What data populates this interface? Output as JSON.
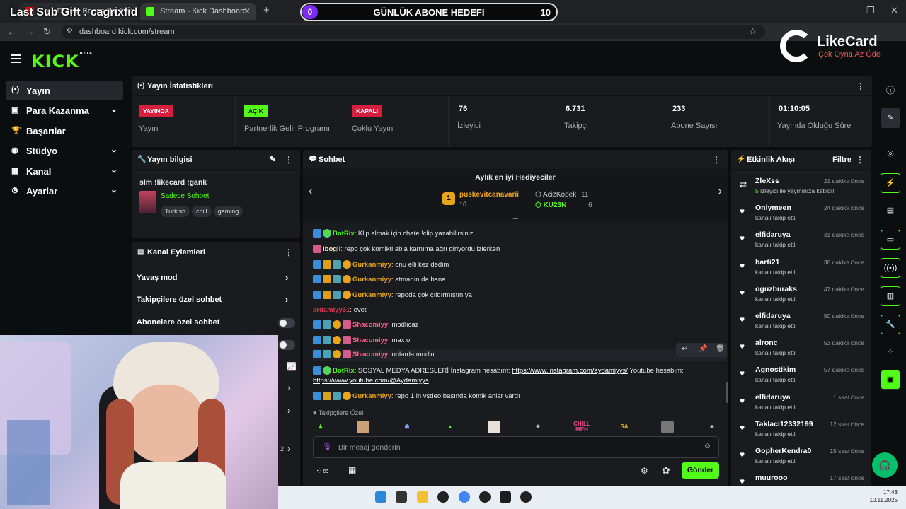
{
  "browser": {
    "tabs": [
      {
        "title": "Lo... Drama Bonus Bin le..."
      },
      {
        "title": "Stream - Kick Dashboard"
      }
    ],
    "url": "dashboard.kick.com/stream"
  },
  "overlay": {
    "last_sub": "Last Sub Gift : cagrixfid",
    "goal": {
      "current": "0",
      "label": "GÜNLÜK ABONE HEDEFI",
      "target": "10"
    },
    "likecard": {
      "name": "LikeCard",
      "slogan": "Çok Oyna   Az Öde"
    }
  },
  "header": {
    "logo": "KICK",
    "logo_sup": "BETA"
  },
  "sidebar": {
    "items": [
      {
        "label": "Yayın",
        "icon": "broadcast-icon"
      },
      {
        "label": "Para Kazanma",
        "icon": "money-icon"
      },
      {
        "label": "Başarılar",
        "icon": "trophy-icon"
      },
      {
        "label": "Stüdyo",
        "icon": "studio-icon"
      },
      {
        "label": "Kanal",
        "icon": "channel-icon"
      },
      {
        "label": "Ayarlar",
        "icon": "settings-icon"
      }
    ]
  },
  "stats": {
    "title": "Yayın İstatistikleri",
    "items": [
      {
        "badge": "YAYINDA",
        "label": "Yayın",
        "color": "#d61f3f"
      },
      {
        "badge": "AÇIK",
        "label": "Partnerlik Gelir Programı",
        "color": "#53fc18"
      },
      {
        "badge": "KAPALI",
        "label": "Çoklu Yayın",
        "color": "#d61f3f"
      },
      {
        "value": "76",
        "label": "İzleyici"
      },
      {
        "value": "6.731",
        "label": "Takipçi"
      },
      {
        "value": "233",
        "label": "Abone Sayısı"
      },
      {
        "value": "01:10:05",
        "label": "Yayında Olduğu Süre"
      }
    ]
  },
  "stream_info": {
    "title": "Yayın bilgisi",
    "stream_title": "slm !likecard !gank",
    "category": "Sadece Sohbet",
    "tags": [
      "Turkish",
      "chill",
      "gaming"
    ]
  },
  "channel_actions": {
    "title": "Kanal Eylemleri",
    "items": [
      "Yavaş mod",
      "Takipçilere özel sohbet",
      "Abonelere özel sohbet"
    ],
    "side_number": "2"
  },
  "chat": {
    "title": "Sohbet",
    "gifters_title": "Aylık en iyi Hediyeciler",
    "gifters": [
      {
        "rank": "1",
        "name": "puskevitcanavarii",
        "count": "16"
      },
      {
        "rank": "2",
        "name": "AcizKopek",
        "count": "11"
      },
      {
        "rank": "3",
        "name": "KU23N",
        "count": "6"
      }
    ],
    "messages": [
      {
        "user": "BotRix",
        "text": ": Klip almak için chate !clip yazabilirsiniz",
        "color": "#53fc18"
      },
      {
        "user": "ibogil",
        "text": ": repo çok komikti abla karnıma ağrı giriyordu izlerken",
        "color": "#f0e6c0"
      },
      {
        "user": "Gurkanmiyy",
        "text": ": onu elli kez dedim",
        "color": "#e9a51a"
      },
      {
        "user": "Gurkanmiyy",
        "text": ": atmadın da bana",
        "color": "#e9a51a"
      },
      {
        "user": "Gurkanmiyy",
        "text": ": repoda çok çıldırmıştın ya",
        "color": "#e9a51a"
      },
      {
        "user": "ardamiyy31",
        "text": ": evet",
        "color": "#d9344f"
      },
      {
        "user": "Shacomiyy",
        "text": ": modlıcaz",
        "color": "#ff5e8a"
      },
      {
        "user": "Shacomiyy",
        "text": ": max o",
        "color": "#ff5e8a"
      },
      {
        "user": "Shacomiyy",
        "text": ": onlarda modlu",
        "color": "#ff5e8a"
      },
      {
        "user": "BotRix",
        "text": ": SOSYAL MEDYA ADRESLERİ İnstagram hesabım: ",
        "link1": "https://www.instagram.com/aydamiyys/",
        "text2": " Youtube hesabım:",
        "link2": "https://www.youtube.com/@Aydamiyys",
        "color": "#53fc18"
      },
      {
        "user": "Gurkanmiyy",
        "text": ": repo 1 in vşdeo başında komik anlar vardı",
        "color": "#e9a51a"
      }
    ],
    "followers_only": "Takipçilere Özel",
    "emotes": [
      "CHILL MEH",
      "SA"
    ],
    "input_placeholder": "Bir mesaj gönderin",
    "send_label": "Gönder"
  },
  "activity": {
    "title": "Etkinlik Akışı",
    "filter": "Filtre",
    "items": [
      {
        "name": "ZleXss",
        "time": "21 dakika önce",
        "desc_count": "5",
        "desc": " izleyici ile yayınınıza katıldı!",
        "icon": "raid-icon"
      },
      {
        "name": "Onlymeen",
        "time": "24 dakika önce",
        "desc": "kanalı takip etti"
      },
      {
        "name": "elfidaruya",
        "time": "31 dakika önce",
        "desc": "kanalı takip etti"
      },
      {
        "name": "barti21",
        "time": "38 dakika önce",
        "desc": "kanalı takip etti"
      },
      {
        "name": "oguzburaks",
        "time": "47 dakika önce",
        "desc": "kanalı takip etti"
      },
      {
        "name": "elfidaruya",
        "time": "50 dakika önce",
        "desc": "kanalı takip etti"
      },
      {
        "name": "alronc",
        "time": "53 dakika önce",
        "desc": "kanalı takip etti"
      },
      {
        "name": "Agnostikim",
        "time": "57 dakika önce",
        "desc": "kanalı takip etti"
      },
      {
        "name": "elfidaruya",
        "time": "1 saat önce",
        "desc": "kanalı takip etti"
      },
      {
        "name": "Taklaci12332199",
        "time": "12 saat önce",
        "desc": "kanalı takip etti"
      },
      {
        "name": "GopherKendra0",
        "time": "15 saat önce",
        "desc": "kanalı takip etti"
      },
      {
        "name": "muurooo",
        "time": "17 saat önce",
        "desc": ""
      }
    ]
  },
  "taskbar": {
    "time": "17:43",
    "date": "10.11.2025"
  },
  "colors": {
    "kick_green": "#53fc18",
    "live_red": "#d61f3f",
    "panel": "#191b1f"
  }
}
